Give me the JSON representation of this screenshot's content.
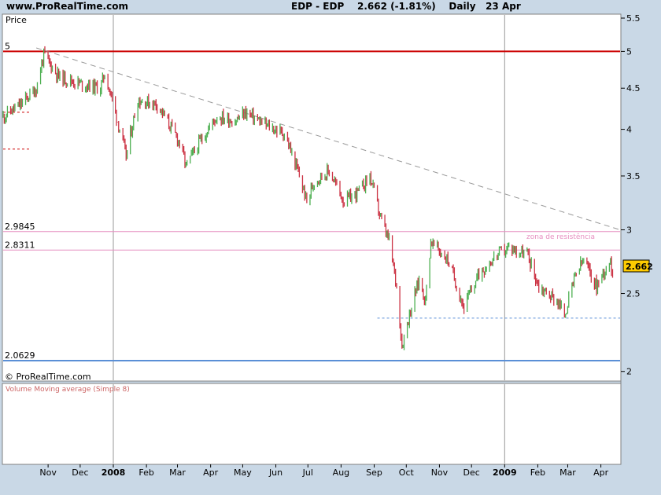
{
  "header": {
    "site": "www.ProRealTime.com",
    "symbol": "EDP - EDP",
    "price": "2.662 (-1.81%)",
    "period": "Daily",
    "date": "23 Apr"
  },
  "price_panel": {
    "label": "Price",
    "copyright": "© ProRealTime.com"
  },
  "volume_panel": {
    "label": "Volume Moving average (Simple 8)"
  },
  "last_price_badge": "2.662",
  "annotation": "zona de resistência",
  "colors": {
    "up": "#4caf50",
    "down": "#cc3344",
    "resistance": "#e68fc0",
    "support_red": "#cc0000",
    "support_blue": "#5a8fd6",
    "trendline": "#999999"
  },
  "chart_data": {
    "type": "candlestick",
    "y_scale": "log",
    "ylim": [
      1.95,
      5.55
    ],
    "y_ticks": [
      "5.5",
      "5",
      "4.5",
      "4",
      "3.5",
      "3",
      "2.5",
      "2"
    ],
    "x_tick_labels": [
      "Nov",
      "Dec",
      "2008",
      "Feb",
      "Mar",
      "Apr",
      "May",
      "Jun",
      "Jul",
      "Aug",
      "Sep",
      "Oct",
      "Nov",
      "Dec",
      "2009",
      "Feb",
      "Mar",
      "Apr"
    ],
    "bold_x_labels": [
      "2008",
      "2009"
    ],
    "levels": [
      {
        "label": "5",
        "value": 5.0,
        "style": "support_red"
      },
      {
        "label": "2.9845",
        "value": 2.9845,
        "style": "resistance"
      },
      {
        "label": "2.8311",
        "value": 2.8311,
        "style": "resistance"
      },
      {
        "label": "2.0629",
        "value": 2.0629,
        "style": "support_blue"
      }
    ],
    "trendline": {
      "from": [
        "2007-11-01",
        5.05
      ],
      "to": [
        "2009-04-30",
        3.0
      ]
    },
    "dashed_support": {
      "value": 2.33,
      "from": "2008-09-15",
      "to": "2009-04-30"
    },
    "left_marks": [
      4.2,
      3.78
    ],
    "anchors": [
      [
        "2007-10-01",
        4.15
      ],
      [
        "2007-10-18",
        4.3
      ],
      [
        "2007-11-01",
        4.5
      ],
      [
        "2007-11-08",
        4.95
      ],
      [
        "2007-11-22",
        4.65
      ],
      [
        "2007-12-14",
        4.55
      ],
      [
        "2007-12-31",
        4.5
      ],
      [
        "2008-01-04",
        4.7
      ],
      [
        "2008-01-18",
        4.0
      ],
      [
        "2008-01-24",
        3.7
      ],
      [
        "2008-02-04",
        4.35
      ],
      [
        "2008-02-22",
        4.3
      ],
      [
        "2008-03-14",
        3.85
      ],
      [
        "2008-03-20",
        3.6
      ],
      [
        "2008-04-04",
        3.9
      ],
      [
        "2008-04-18",
        4.15
      ],
      [
        "2008-05-05",
        4.1
      ],
      [
        "2008-05-15",
        4.2
      ],
      [
        "2008-06-02",
        4.05
      ],
      [
        "2008-06-20",
        3.95
      ],
      [
        "2008-07-04",
        3.5
      ],
      [
        "2008-07-11",
        3.25
      ],
      [
        "2008-07-18",
        3.45
      ],
      [
        "2008-08-01",
        3.55
      ],
      [
        "2008-08-15",
        3.25
      ],
      [
        "2008-08-29",
        3.35
      ],
      [
        "2008-09-08",
        3.5
      ],
      [
        "2008-09-18",
        3.1
      ],
      [
        "2008-09-26",
        2.9
      ],
      [
        "2008-10-03",
        2.55
      ],
      [
        "2008-10-08",
        2.15
      ],
      [
        "2008-10-13",
        2.3
      ],
      [
        "2008-10-24",
        2.6
      ],
      [
        "2008-10-30",
        2.45
      ],
      [
        "2008-11-04",
        2.9
      ],
      [
        "2008-11-20",
        2.75
      ],
      [
        "2008-12-05",
        2.4
      ],
      [
        "2008-12-19",
        2.65
      ],
      [
        "2009-01-06",
        2.8
      ],
      [
        "2009-01-16",
        2.85
      ],
      [
        "2009-02-02",
        2.8
      ],
      [
        "2009-02-13",
        2.55
      ],
      [
        "2009-03-02",
        2.45
      ],
      [
        "2009-03-09",
        2.35
      ],
      [
        "2009-03-20",
        2.65
      ],
      [
        "2009-03-27",
        2.75
      ],
      [
        "2009-04-08",
        2.55
      ],
      [
        "2009-04-20",
        2.75
      ],
      [
        "2009-04-23",
        2.66
      ]
    ]
  }
}
